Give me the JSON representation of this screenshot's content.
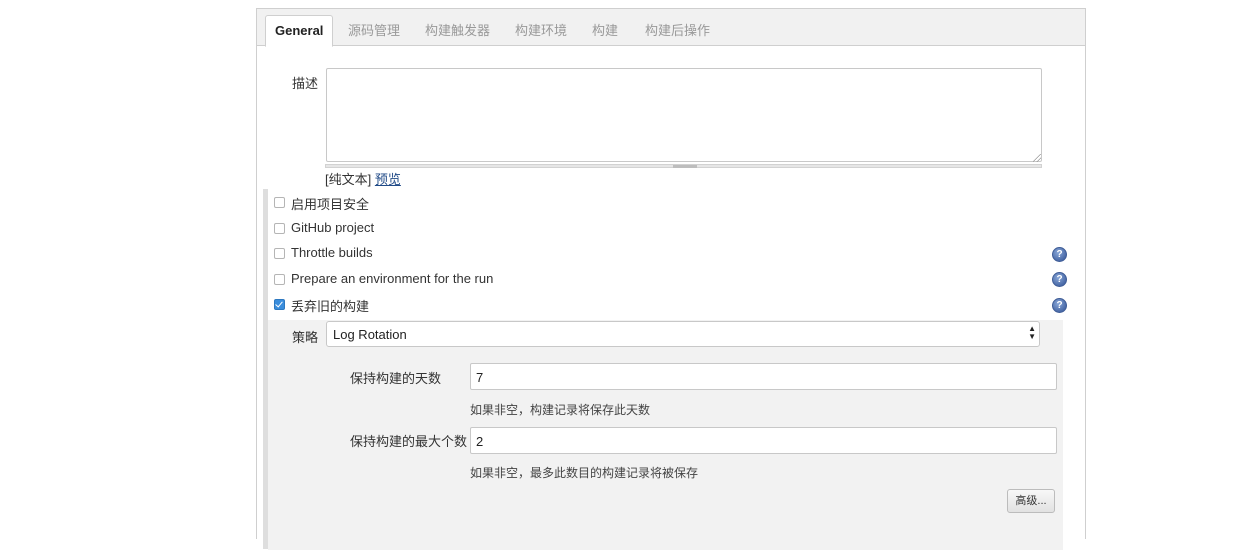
{
  "tabs": [
    {
      "label": "General",
      "active": true
    },
    {
      "label": "源码管理"
    },
    {
      "label": "构建触发器"
    },
    {
      "label": "构建环境"
    },
    {
      "label": "构建"
    },
    {
      "label": "构建后操作"
    }
  ],
  "description": {
    "label": "描述",
    "value": "",
    "format_prefix": "[纯文本]",
    "preview_link": "预览"
  },
  "options": [
    {
      "label": "启用项目安全",
      "checked": false,
      "help": false
    },
    {
      "label": "GitHub project",
      "checked": false,
      "help": false
    },
    {
      "label": "Throttle builds",
      "checked": false,
      "help": true
    },
    {
      "label": "Prepare an environment for the run",
      "checked": false,
      "help": true
    },
    {
      "label": "丢弃旧的构建",
      "checked": true,
      "help": true
    }
  ],
  "help_icon_glyph": "?",
  "discard": {
    "strategy_label": "策略",
    "strategy_value": "Log Rotation",
    "days_label": "保持构建的天数",
    "days_value": "7",
    "days_hint": "如果非空，构建记录将保存此天数",
    "max_label": "保持构建的最大个数",
    "max_value": "2",
    "max_hint": "如果非空，最多此数目的构建记录将被保存",
    "advanced_button": "高级..."
  },
  "colors": {
    "accent": "#3a8ddc",
    "link": "#204a87",
    "tabbar_bg": "#f1f1f1",
    "nested_bg": "#f2f2f2"
  }
}
